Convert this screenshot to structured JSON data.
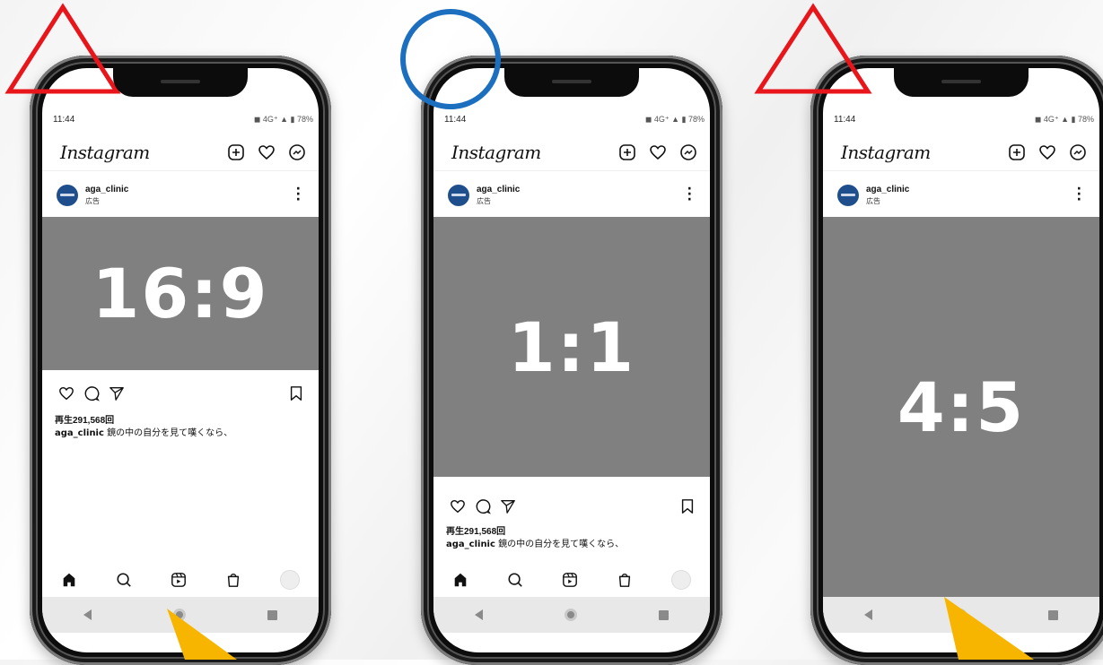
{
  "colors": {
    "media_bg": "#808080",
    "triangle": "#e8151b",
    "circle": "#1c6fbf",
    "arrow": "#f7b500"
  },
  "phones": [
    {
      "status_time": "11:44",
      "status_right": "◼ 4G⁺ ▲ ▮ 78%",
      "logo": "Instagram",
      "username": "aga_clinic",
      "ad_label": "広告",
      "ratio_label": "16:9",
      "views": "再生291,568回",
      "caption_user": "aga_clinic",
      "caption_text": "鏡の中の自分を見て嘆くなら、",
      "marker": "triangle",
      "arrow": true
    },
    {
      "status_time": "11:44",
      "status_right": "◼ 4G⁺ ▲ ▮ 78%",
      "logo": "Instagram",
      "username": "aga_clinic",
      "ad_label": "広告",
      "ratio_label": "1:1",
      "views": "再生291,568回",
      "caption_user": "aga_clinic",
      "caption_text": "鏡の中の自分を見て嘆くなら、",
      "marker": "circle",
      "arrow": false
    },
    {
      "status_time": "11:44",
      "status_right": "◼ 4G⁺ ▲ ▮ 78%",
      "logo": "Instagram",
      "username": "aga_clinic",
      "ad_label": "広告",
      "ratio_label": "4:5",
      "marker": "triangle",
      "arrow": true
    }
  ]
}
